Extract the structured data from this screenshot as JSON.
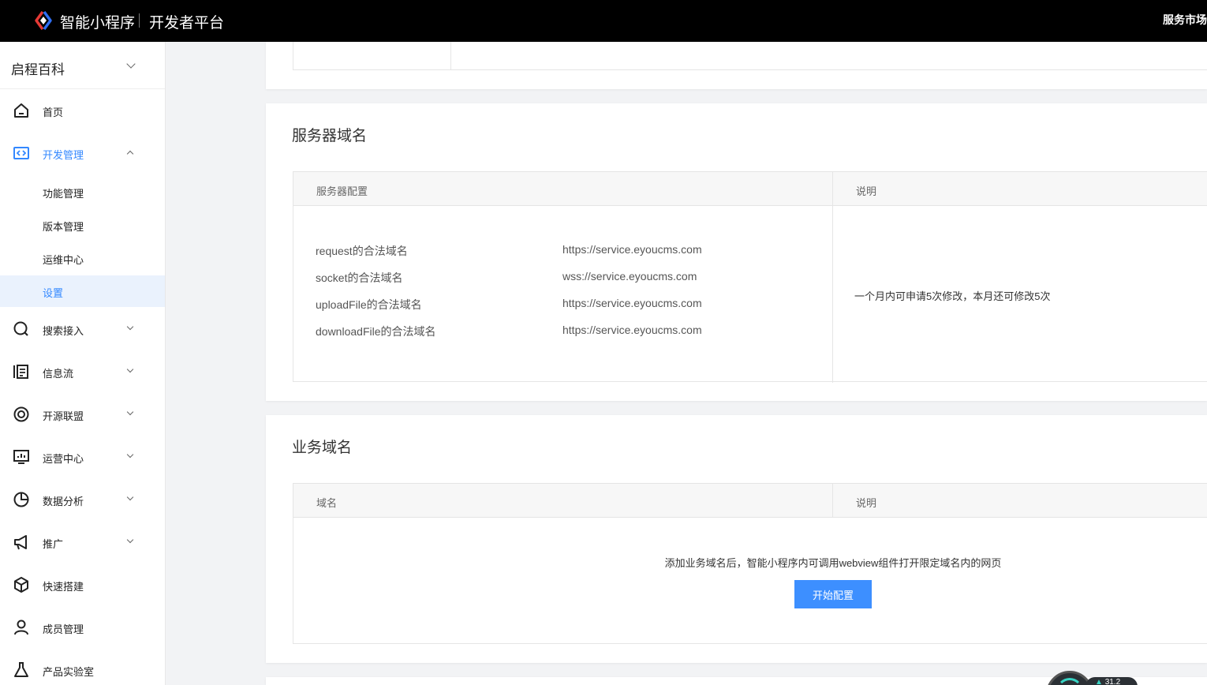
{
  "topbar": {
    "brand": "智能小程序",
    "brand_sub": "开发者平台",
    "market": "服务市场",
    "accent": "#3388ff"
  },
  "sidebar": {
    "app_name": "启程百科",
    "items": [
      {
        "label": "首页",
        "icon": "home-icon"
      },
      {
        "label": "开发管理",
        "icon": "code-icon",
        "active": true,
        "expanded": true
      },
      {
        "label": "搜索接入",
        "icon": "search-icon"
      },
      {
        "label": "信息流",
        "icon": "feed-icon"
      },
      {
        "label": "开源联盟",
        "icon": "target-icon"
      },
      {
        "label": "运营中心",
        "icon": "monitor-icon"
      },
      {
        "label": "数据分析",
        "icon": "pie-chart-icon"
      },
      {
        "label": "推广",
        "icon": "megaphone-icon"
      },
      {
        "label": "快速搭建",
        "icon": "cube-icon"
      },
      {
        "label": "成员管理",
        "icon": "user-icon"
      },
      {
        "label": "产品实验室",
        "icon": "flask-icon"
      }
    ],
    "subitems": [
      {
        "label": "功能管理"
      },
      {
        "label": "版本管理"
      },
      {
        "label": "运维中心"
      },
      {
        "label": "设置",
        "selected": true
      }
    ]
  },
  "server_domain": {
    "title": "服务器域名",
    "col_config": "服务器配置",
    "col_desc": "说明",
    "rows": [
      {
        "key": "request的合法域名",
        "value": "https://service.eyoucms.com"
      },
      {
        "key": "socket的合法域名",
        "value": "wss://service.eyoucms.com"
      },
      {
        "key": "uploadFile的合法域名",
        "value": "https://service.eyoucms.com"
      },
      {
        "key": "downloadFile的合法域名",
        "value": "https://service.eyoucms.com"
      }
    ],
    "note": "一个月内可申请5次修改，本月还可修改5次"
  },
  "business_domain": {
    "title": "业务域名",
    "col_domain": "域名",
    "col_desc": "说明",
    "tip": "添加业务域名后，智能小程序内可调用webview组件打开限定域名内的网页",
    "button": "开始配置"
  },
  "widget": {
    "value": "31.2"
  }
}
